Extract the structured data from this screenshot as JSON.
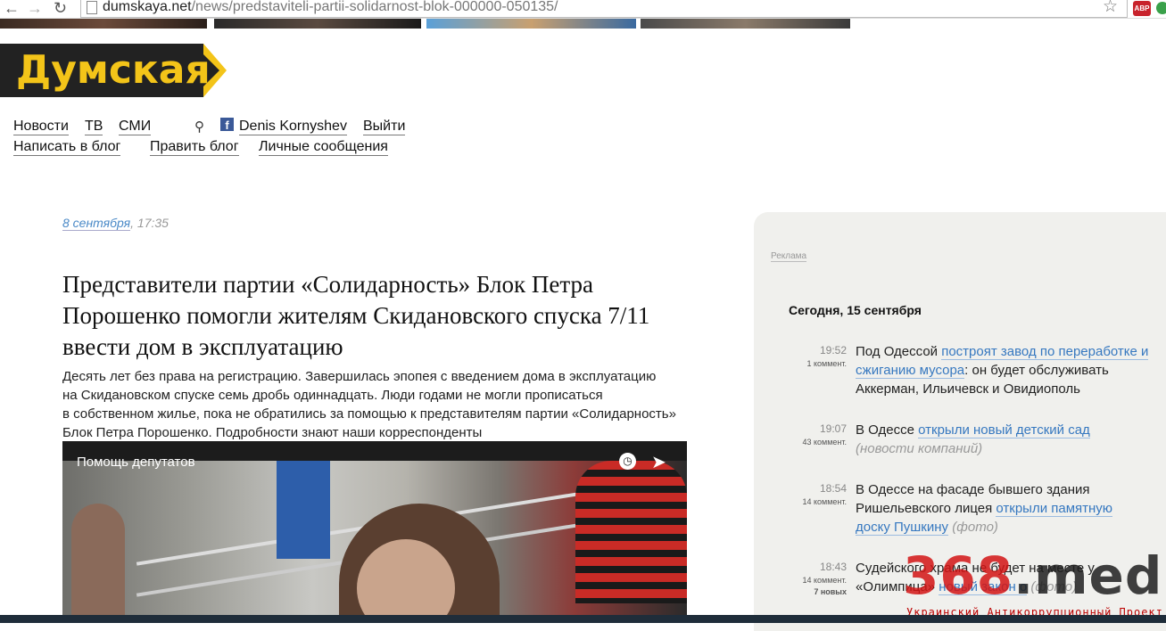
{
  "browser": {
    "url_host": "dumskaya.net",
    "url_path": "/news/predstaviteli-partii-solidarnost-blok-000000-050135/",
    "abp_label": "ABP"
  },
  "site": {
    "logo": "Думская"
  },
  "nav": {
    "row1": [
      "Новости",
      "ТВ",
      "СМИ"
    ],
    "user": "Denis Kornyshev",
    "logout": "Выйти",
    "row2": [
      "Написать в блог",
      "Править блог",
      "Личные сообщения"
    ]
  },
  "article": {
    "date": "8 сентября",
    "time": ", 17:35",
    "headline": "Представители партии «Солидарность» Блок Петра Порошенко помогли жителям Скидановского спуска 7/11 ввести дом в эксплуатацию",
    "lead_lines": [
      "Десять лет без права на регистрацию. Завершилась эпопея с введением дома в эксплуатацию",
      "на Скидановском спуске семь дробь одиннадцать. Люди годами не могли прописаться",
      "в собственном жилье, пока не обратились за помощью к представителям партии «Солидарность»",
      "Блок Петра Порошенко. Подробности знают наши корреспонденты"
    ],
    "video_title": "Помощь депутатов"
  },
  "sidebar": {
    "ad_label": "Реклама",
    "today": "Сегодня, 15 сентября",
    "news": [
      {
        "time": "19:52",
        "comments": "1 коммент.",
        "pre": "Под Одессой ",
        "link": "построят завод по переработке и сжиганию мусора",
        "post": ": он будет обслуживать Аккерман, Ильичевск и Овидиополь",
        "note": ""
      },
      {
        "time": "19:07",
        "comments": "43 коммент.",
        "pre": "В Одессе ",
        "link": "открыли новый детский сад",
        "post": " ",
        "note": "(новости компаний)"
      },
      {
        "time": "18:54",
        "comments": "14 коммент.",
        "pre": "В Одессе на фасаде бывшего здания Ришельевского лицея ",
        "link": "открыли памятную доску Пушкину",
        "post": " ",
        "note": "(фото)"
      },
      {
        "time": "18:43",
        "comments": "14 коммент.",
        "new": "7 новых",
        "pre": "Судейского храма не будет на месте у «Олимпица» ",
        "link": "новый закон о",
        "post": " ",
        "note": "(фото)"
      }
    ]
  },
  "watermark": {
    "big_red": "368",
    "big_dark": ".media",
    "tagline": "Украинский Антикоррупционный Проект"
  }
}
